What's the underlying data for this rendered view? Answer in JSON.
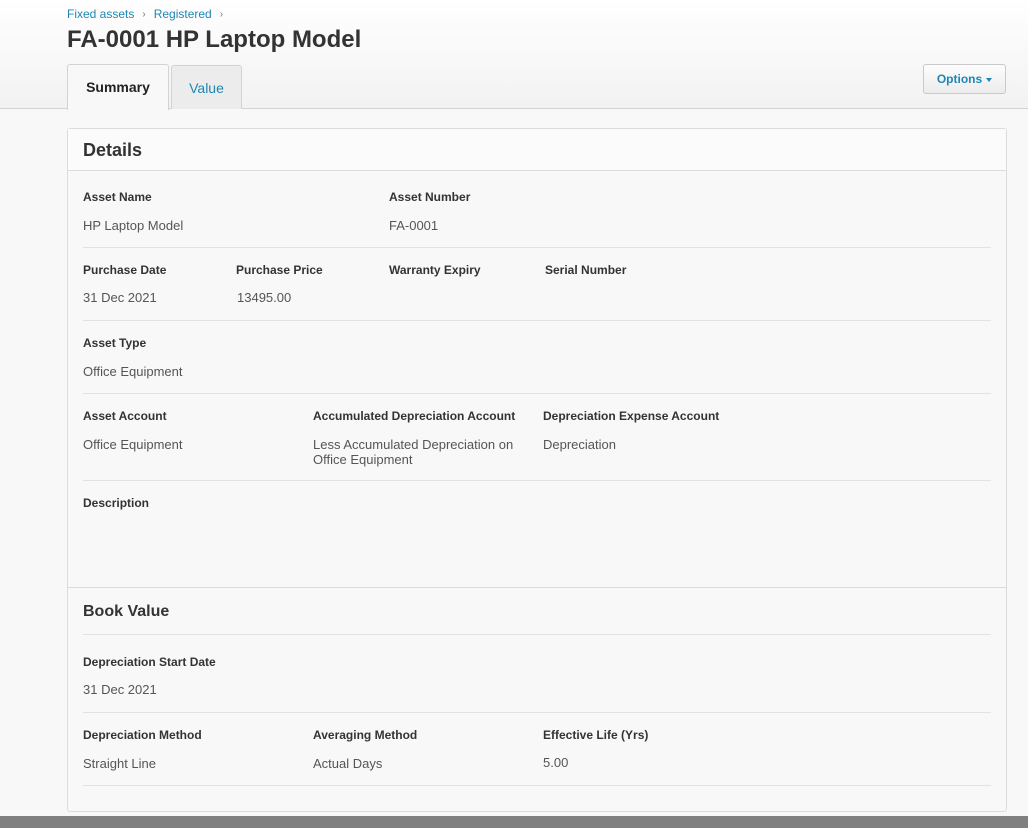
{
  "breadcrumb": {
    "item1": "Fixed assets",
    "item2": "Registered",
    "sep": "›"
  },
  "page": {
    "title": "FA-0001 HP Laptop Model"
  },
  "tabs": [
    {
      "label": "Summary"
    },
    {
      "label": "Value"
    }
  ],
  "options": {
    "label": "Options"
  },
  "details": {
    "title": "Details",
    "asset_name_label": "Asset Name",
    "asset_name": "HP Laptop Model",
    "asset_number_label": "Asset Number",
    "asset_number": "FA-0001",
    "purchase_date_label": "Purchase Date",
    "purchase_date": "31 Dec 2021",
    "purchase_price_label": "Purchase Price",
    "purchase_price": "13495.00",
    "warranty_expiry_label": "Warranty Expiry",
    "warranty_expiry": "",
    "serial_number_label": "Serial Number",
    "serial_number": "",
    "asset_type_label": "Asset Type",
    "asset_type": "Office Equipment",
    "asset_account_label": "Asset Account",
    "asset_account": "Office Equipment",
    "accum_dep_label": "Accumulated Depreciation Account",
    "accum_dep": "Less Accumulated Depreciation on Office Equipment",
    "dep_expense_label": "Depreciation Expense Account",
    "dep_expense": "Depreciation",
    "description_label": "Description",
    "description": ""
  },
  "book_value": {
    "title": "Book Value",
    "dep_start_label": "Depreciation Start Date",
    "dep_start": "31 Dec 2021",
    "dep_method_label": "Depreciation Method",
    "dep_method": "Straight Line",
    "avg_method_label": "Averaging Method",
    "avg_method": "Actual Days",
    "eff_life_label": "Effective Life (Yrs)",
    "eff_life": "5.00"
  }
}
